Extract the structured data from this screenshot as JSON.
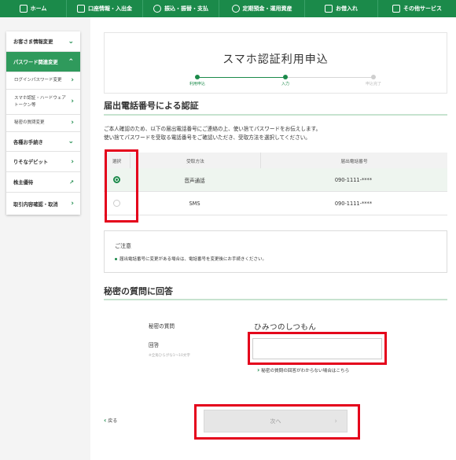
{
  "nav": {
    "items": [
      {
        "label": "ホーム",
        "icon": "home-icon"
      },
      {
        "label": "口座情報・入出金",
        "icon": "account-icon"
      },
      {
        "label": "振込・振替・支払",
        "icon": "transfer-icon"
      },
      {
        "label": "定期預金・運用資産",
        "icon": "piggy-bank-icon"
      },
      {
        "label": "お借入れ",
        "icon": "loan-icon"
      },
      {
        "label": "その他サービス",
        "icon": "grid-icon"
      }
    ]
  },
  "sidebar": {
    "customer_info": "お客さま情報変更",
    "password": "パスワード関連変更",
    "sub_login_password": "ログインパスワード変更",
    "sub_smartphone_1": "スマホ認証・ハードウェア",
    "sub_smartphone_2": "トークン等",
    "sub_secret_question": "秘密の質問変更",
    "procedures": "各種お手続き",
    "debit": "りそなデビット",
    "shareholder": "株主優待",
    "history": "取引内容確認・取消"
  },
  "page": {
    "title": "スマホ認証利用申込",
    "steps": [
      "利用申込",
      "入力",
      "申込完了"
    ]
  },
  "auth_section": {
    "heading": "届出電話番号による認証",
    "description_line1": "ご本人確認のため、以下の届出電話番号にご連絡の上、使い捨てパスワードをお伝えします。",
    "description_line2": "使い捨てパスワードを受取る電話番号をご確認いただき、受取方法を選択してください。",
    "table": {
      "headers": [
        "選択",
        "受取方法",
        "届出電話番号"
      ],
      "rows": [
        {
          "method": "音声通話",
          "phone": "090-1111-****",
          "selected": true
        },
        {
          "method": "SMS",
          "phone": "090-1111-****",
          "selected": false
        }
      ]
    }
  },
  "notice": {
    "title": "ご注意",
    "item": "届出電話番号に変更がある場合は、電話番号を変更後にお手続きください。"
  },
  "secret_section": {
    "heading": "秘密の質問に回答",
    "question_label": "秘密の質問",
    "question_value": "ひみつのしつもん",
    "answer_label": "回答",
    "answer_hint": "※全角ひらがな1～10文字",
    "answer_value": "",
    "help_link": "秘密の質問の回答がわからない場合はこちら"
  },
  "footer": {
    "back": "戻る",
    "next": "次へ"
  },
  "colors": {
    "brand_green": "#1b8a4a",
    "highlight_red": "#e4001b"
  }
}
